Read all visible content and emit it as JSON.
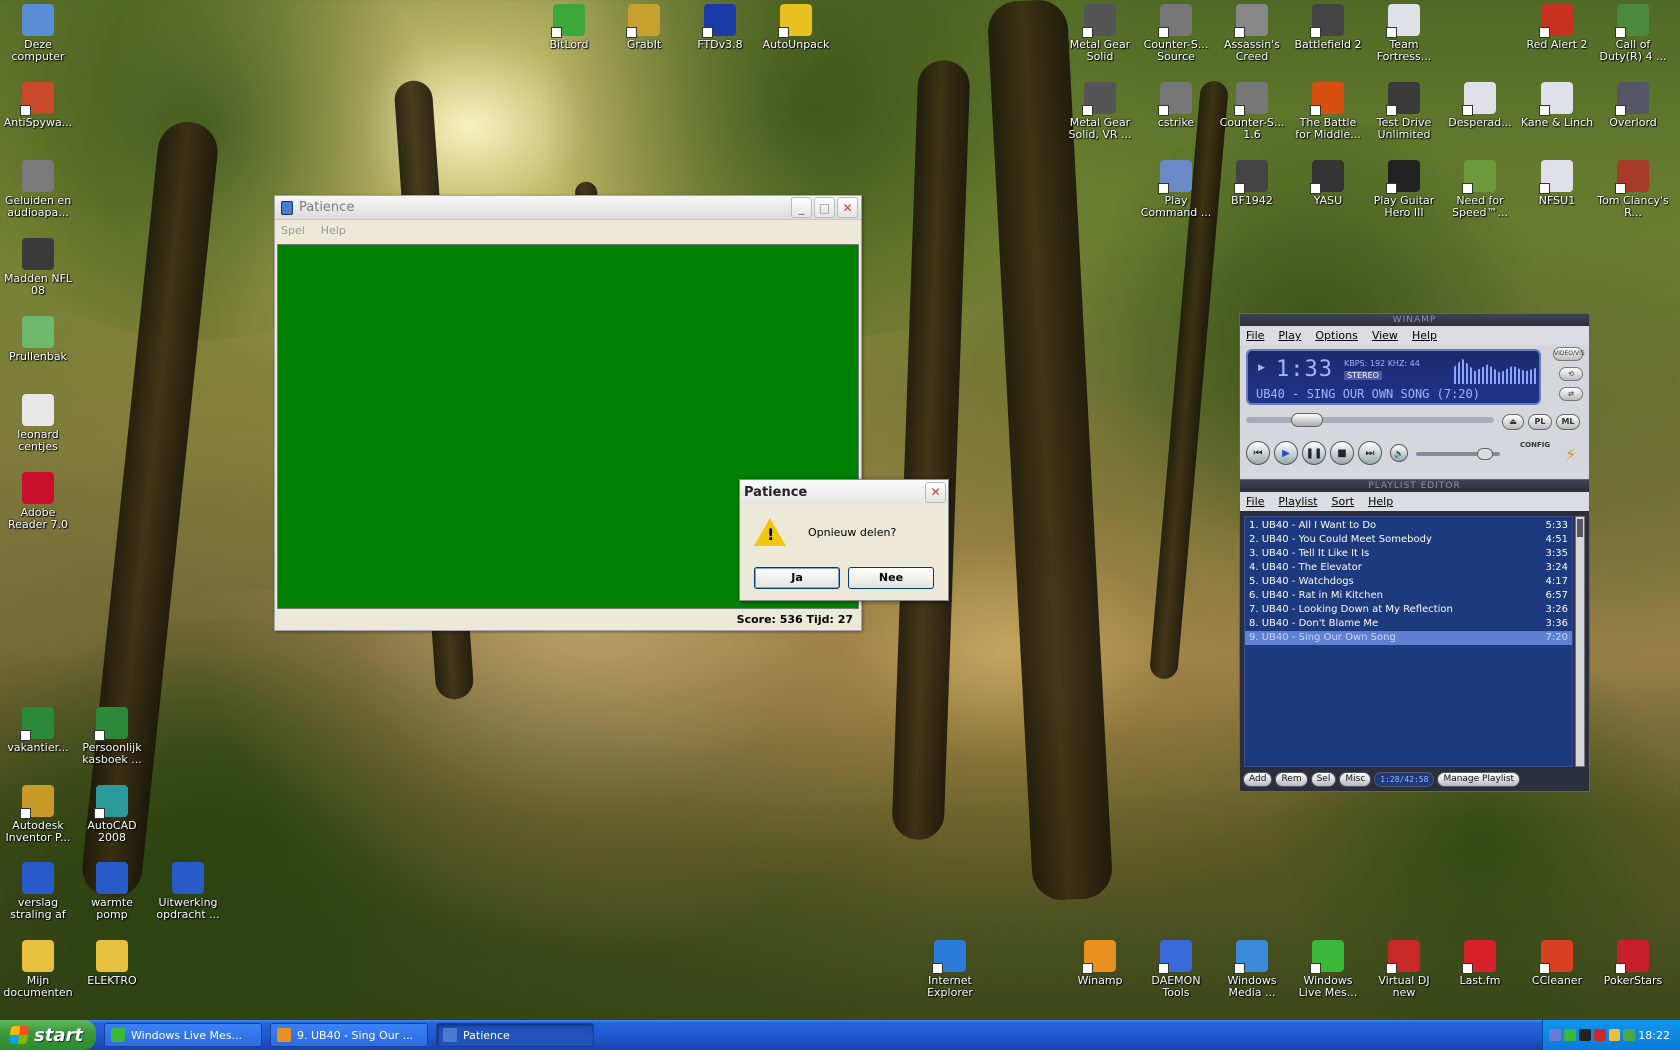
{
  "desktop_icons": [
    {
      "label": "Deze computer",
      "icon": "computer-icon",
      "color": "#5a8fd8"
    },
    {
      "label": "AntiSpywa...",
      "icon": "antispyware-icon",
      "color": "#c84a2a"
    },
    {
      "label": "Geluiden en audioapa...",
      "icon": "speaker-icon",
      "color": "#7a7a7a"
    },
    {
      "label": "Madden NFL 08",
      "icon": "madden-icon",
      "color": "#3a3a3a"
    },
    {
      "label": "Prullenbak",
      "icon": "recycle-bin-icon",
      "color": "#6db86d"
    },
    {
      "label": "leonard centjes",
      "icon": "document-icon",
      "color": "#e8e8e8"
    },
    {
      "label": "Adobe Reader 7.0",
      "icon": "adobe-reader-icon",
      "color": "#c8102e"
    },
    {
      "label": "vakantier...",
      "icon": "excel-icon",
      "color": "#2a8a3a"
    },
    {
      "label": "Persoonlijk kasboek ...",
      "icon": "excel-icon",
      "color": "#2a8a3a"
    },
    {
      "label": "Autodesk Inventor P...",
      "icon": "inventor-icon",
      "color": "#c89a2a"
    },
    {
      "label": "AutoCAD 2008",
      "icon": "autocad-icon",
      "color": "#2a9a9a"
    },
    {
      "label": "verslag straling af",
      "icon": "word-icon",
      "color": "#2a5ac8"
    },
    {
      "label": "warmte pomp",
      "icon": "word-icon",
      "color": "#2a5ac8"
    },
    {
      "label": "Uitwerking opdracht ...",
      "icon": "word-icon",
      "color": "#2a5ac8"
    },
    {
      "label": "Mijn documenten",
      "icon": "folder-icon",
      "color": "#e8c040"
    },
    {
      "label": "ELEKTRO",
      "icon": "folder-icon",
      "color": "#e8c040"
    },
    {
      "label": "BitLord",
      "icon": "bitlord-icon",
      "color": "#3aa83a"
    },
    {
      "label": "GrabIt",
      "icon": "grabit-icon",
      "color": "#c8a030"
    },
    {
      "label": "FTDv3.8",
      "icon": "ftd-icon",
      "color": "#1a3aa8"
    },
    {
      "label": "AutoUnpack",
      "icon": "autounpack-icon",
      "color": "#e8c020"
    },
    {
      "label": "Metal Gear Solid",
      "icon": "metal-gear-icon",
      "color": "#555555"
    },
    {
      "label": "Counter-S... Source",
      "icon": "counter-strike-icon",
      "color": "#777777"
    },
    {
      "label": "Assassin's Creed",
      "icon": "assassins-creed-icon",
      "color": "#888888"
    },
    {
      "label": "Battlefield 2",
      "icon": "battlefield-icon",
      "color": "#444444"
    },
    {
      "label": "Team Fortress...",
      "icon": "window-icon",
      "color": "#e0e0e8"
    },
    {
      "label": "Red Alert 2",
      "icon": "red-alert-icon",
      "color": "#c83020"
    },
    {
      "label": "Call of Duty(R) 4 ...",
      "icon": "call-of-duty-icon",
      "color": "#4a8a3a"
    },
    {
      "label": "Metal Gear Solid, VR ...",
      "icon": "metal-gear-icon",
      "color": "#555555"
    },
    {
      "label": "cstrike",
      "icon": "counter-strike-icon",
      "color": "#777777"
    },
    {
      "label": "Counter-S... 1.6",
      "icon": "counter-strike-icon",
      "color": "#777777"
    },
    {
      "label": "The Battle for Middle...",
      "icon": "battle-middle-earth-icon",
      "color": "#d85010"
    },
    {
      "label": "Test Drive Unlimited",
      "icon": "test-drive-icon",
      "color": "#3a3a3a"
    },
    {
      "label": "Desperad...",
      "icon": "window-icon",
      "color": "#e0e0e8"
    },
    {
      "label": "Kane & Linch",
      "icon": "window-icon",
      "color": "#e0e0e8"
    },
    {
      "label": "Overlord",
      "icon": "overlord-icon",
      "color": "#555566"
    },
    {
      "label": "Play Command ...",
      "icon": "command-conquer-icon",
      "color": "#6a8ac8"
    },
    {
      "label": "BF1942",
      "icon": "battlefield-icon",
      "color": "#444444"
    },
    {
      "label": "YASU",
      "icon": "yasu-icon",
      "color": "#333333"
    },
    {
      "label": "Play Guitar Hero III",
      "icon": "guitar-hero-icon",
      "color": "#222222"
    },
    {
      "label": "Need for Speed™...",
      "icon": "need-for-speed-icon",
      "color": "#6a9a3a"
    },
    {
      "label": "NFSU1",
      "icon": "window-icon",
      "color": "#e0e0e8"
    },
    {
      "label": "Tom Clancy's R...",
      "icon": "rainbow-six-icon",
      "color": "#a83a2a"
    },
    {
      "label": "Internet Explorer",
      "icon": "internet-explorer-icon",
      "color": "#2a7ad8"
    },
    {
      "label": "Winamp",
      "icon": "winamp-icon",
      "color": "#e89020"
    },
    {
      "label": "DAEMON Tools",
      "icon": "daemon-tools-icon",
      "color": "#3a6ad8"
    },
    {
      "label": "Windows Media ...",
      "icon": "windows-media-icon",
      "color": "#3a8ad8"
    },
    {
      "label": "Windows Live Mes...",
      "icon": "messenger-icon",
      "color": "#3ab83a"
    },
    {
      "label": "Virtual DJ new",
      "icon": "virtual-dj-icon",
      "color": "#c82a2a"
    },
    {
      "label": "Last.fm",
      "icon": "lastfm-icon",
      "color": "#d8202a"
    },
    {
      "label": "CCleaner",
      "icon": "ccleaner-icon",
      "color": "#d84020"
    },
    {
      "label": "PokerStars",
      "icon": "pokerstars-icon",
      "color": "#c8202a"
    }
  ],
  "patience": {
    "title": "Patience",
    "menu": [
      "Spel",
      "Help"
    ],
    "felt_color": "#008000",
    "status": "Score: 536 Tijd: 27",
    "buttons": {
      "minimize": "_",
      "maximize": "□",
      "close": "✕"
    }
  },
  "dialog": {
    "title": "Patience",
    "message": "Opnieuw delen?",
    "yes": "Ja",
    "no": "Nee",
    "close": "✕"
  },
  "winamp": {
    "title": "WINAMP",
    "menu": [
      "File",
      "Play",
      "Options",
      "View",
      "Help"
    ],
    "time": "1:33",
    "kbps": "KBPS: 192  KHZ: 44",
    "stereo": "STEREO",
    "song": "UB40 - SING OUR OWN SONG (7:20)",
    "video_vis": "VIDEO/VIS",
    "pl_button": "PL",
    "ml_button": "ML",
    "config": "CONFIG",
    "seek_position": 0.21,
    "volume_level": 0.9
  },
  "playlist": {
    "title": "PLAYLIST EDITOR",
    "menu": [
      "File",
      "Playlist",
      "Sort",
      "Help"
    ],
    "tracks": [
      {
        "name": "1. UB40 - All I Want to Do",
        "length": "5:33"
      },
      {
        "name": "2. UB40 - You Could Meet Somebody",
        "length": "4:51"
      },
      {
        "name": "3. UB40 - Tell It Like It Is",
        "length": "3:35"
      },
      {
        "name": "4. UB40 - The Elevator",
        "length": "3:24"
      },
      {
        "name": "5. UB40 - Watchdogs",
        "length": "4:17"
      },
      {
        "name": "6. UB40 - Rat in Mi Kitchen",
        "length": "6:57"
      },
      {
        "name": "7. UB40 - Looking Down at My Reflection",
        "length": "3:26"
      },
      {
        "name": "8. UB40 - Don't Blame Me",
        "length": "3:36"
      },
      {
        "name": "9. UB40 - Sing Our Own Song",
        "length": "7:20"
      }
    ],
    "selected_index": 8,
    "footer": {
      "add": "Add",
      "rem": "Rem",
      "sel": "Sel",
      "misc": "Misc",
      "time": "1:28/42:58",
      "manage": "Manage Playlist"
    }
  },
  "taskbar": {
    "start": "start",
    "buttons": [
      {
        "label": "Windows Live Mes...",
        "icon": "messenger-icon",
        "color": "#3ab83a"
      },
      {
        "label": "9. UB40 - Sing Our ...",
        "icon": "winamp-icon",
        "color": "#e89020"
      },
      {
        "label": "Patience",
        "icon": "patience-icon",
        "color": "#4a7bd1"
      }
    ],
    "active_index": 2,
    "clock": "18:22"
  }
}
